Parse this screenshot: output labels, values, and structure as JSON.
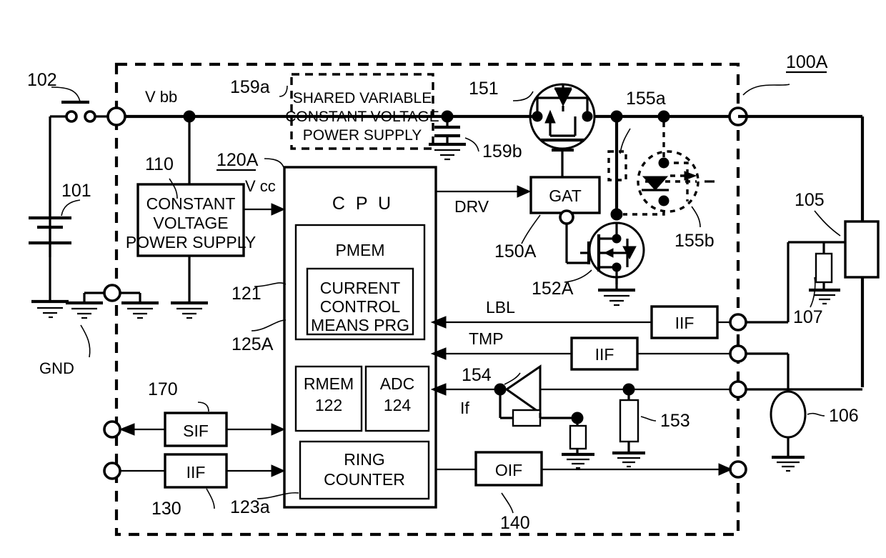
{
  "figure": {
    "type": "patent-circuit-diagram",
    "title_ref": "100A",
    "background": "#ffffff",
    "line_color": "#000000"
  },
  "reference_numerals": {
    "device_100A": "100A",
    "battery_101": "101",
    "switch_102": "102",
    "load_105": "105",
    "element_106": "106",
    "element_107": "107",
    "cvps_110": "110",
    "control_unit_120A": "120A",
    "pmem_121": "121",
    "rmem_122": "122",
    "ring_counter_123a": "123a",
    "adc_124": "124",
    "prg_125A": "125A",
    "iif_130": "130",
    "oif_140": "140",
    "gat_150A": "150A",
    "upper_fet_151": "151",
    "lower_fet_152A": "152A",
    "shunt_153": "153",
    "amp_154": "154",
    "contact_155a": "155a",
    "contact_155b": "155b",
    "shared_supply_159a": "159a",
    "capacitor_159b": "159b",
    "sif_170": "170"
  },
  "labels": {
    "vbb": "V bb",
    "vcc": "V cc",
    "gnd": "GND",
    "drv": "DRV",
    "lbl": "LBL",
    "tmp": "TMP",
    "if": "If"
  },
  "blocks": {
    "shared_supply": {
      "lines": [
        "SHARED VARIABLE",
        "CONSTANT VOLTAGE",
        "POWER SUPPLY"
      ],
      "style": "dashed"
    },
    "constant_voltage_power_supply": {
      "lines": [
        "CONSTANT",
        "VOLTAGE",
        "POWER SUPPLY"
      ]
    },
    "cpu": {
      "label": "C P U"
    },
    "pmem": {
      "label": "PMEM"
    },
    "current_control_means_prg": {
      "lines": [
        "CURRENT",
        "CONTROL",
        "MEANS PRG"
      ]
    },
    "rmem": {
      "label": "RMEM",
      "num": "122"
    },
    "adc": {
      "label": "ADC",
      "num": "124"
    },
    "ring_counter": {
      "lines": [
        "RING",
        "COUNTER"
      ]
    },
    "gat": {
      "label": "GAT"
    },
    "sif": {
      "label": "SIF"
    },
    "iif_left": {
      "label": "IIF"
    },
    "iif_lbl": {
      "label": "IIF"
    },
    "iif_tmp": {
      "label": "IIF"
    },
    "oif": {
      "label": "OIF"
    }
  },
  "terminals": {
    "vbb_terminal": "open-circle",
    "gnd_terminal": "open-circle",
    "sif_terminal": "open-circle",
    "iif_terminal": "open-circle",
    "out_terminal": "open-circle",
    "lbl_terminal": "open-circle",
    "tmp_terminal": "open-circle",
    "if_terminal": "open-circle",
    "oif_terminal": "open-circle"
  },
  "icons": {
    "ground": "ground-icon",
    "battery": "battery-icon",
    "switch": "switch-icon",
    "mosfet_upper": "mosfet-p-channel-icon",
    "mosfet_lower": "mosfet-n-channel-icon",
    "opto_coupler": "opto-coupler-icon",
    "capacitor": "capacitor-icon",
    "resistor": "resistor-icon",
    "amplifier": "amplifier-icon",
    "lamp": "lamp-icon"
  }
}
